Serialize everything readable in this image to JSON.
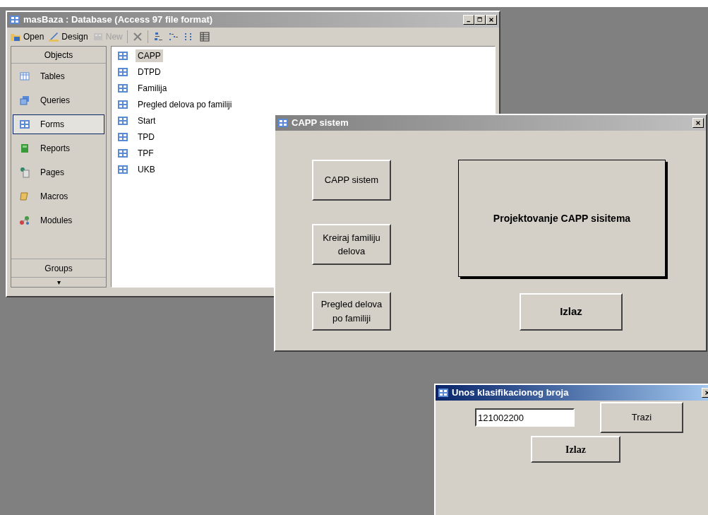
{
  "db_window": {
    "title": "masBaza : Database (Access 97 file format)",
    "active": false,
    "toolbar": [
      {
        "kind": "open",
        "label": "Open",
        "disabled": false
      },
      {
        "kind": "design",
        "label": "Design",
        "disabled": false
      },
      {
        "kind": "new",
        "label": "New",
        "disabled": true
      },
      {
        "kind": "delete"
      },
      {
        "kind": "large-icons"
      },
      {
        "kind": "small-icons"
      },
      {
        "kind": "list"
      },
      {
        "kind": "details"
      }
    ],
    "sidebar": {
      "header": "Objects",
      "items": [
        {
          "kind": "tables",
          "label": "Tables",
          "selected": false
        },
        {
          "kind": "queries",
          "label": "Queries",
          "selected": false
        },
        {
          "kind": "forms",
          "label": "Forms",
          "selected": true
        },
        {
          "kind": "reports",
          "label": "Reports",
          "selected": false
        },
        {
          "kind": "pages",
          "label": "Pages",
          "selected": false
        },
        {
          "kind": "macros",
          "label": "Macros",
          "selected": false
        },
        {
          "kind": "modules",
          "label": "Modules",
          "selected": false
        }
      ],
      "groups": "Groups",
      "more": "▾"
    },
    "items": [
      {
        "label": "CAPP",
        "selected": true
      },
      {
        "label": "DTPD",
        "selected": false
      },
      {
        "label": "Familija",
        "selected": false
      },
      {
        "label": "Pregled delova po familiji",
        "selected": false
      },
      {
        "label": "Start",
        "selected": false
      },
      {
        "label": "TPD",
        "selected": false
      },
      {
        "label": "TPF",
        "selected": false
      },
      {
        "label": "UKB",
        "selected": false
      }
    ]
  },
  "capp_window": {
    "title": "CAPP sistem",
    "active": false,
    "buttons": [
      "CAPP sistem",
      "Kreiraj familiju delova",
      "Pregled delova po familiji"
    ],
    "banner": "Projektovanje CAPP sisitema",
    "exit": "Izlaz"
  },
  "search_window": {
    "title": "Unos klasifikacionog broja",
    "active": true,
    "value": "121002200",
    "search": "Trazi",
    "exit": "Izlaz"
  }
}
